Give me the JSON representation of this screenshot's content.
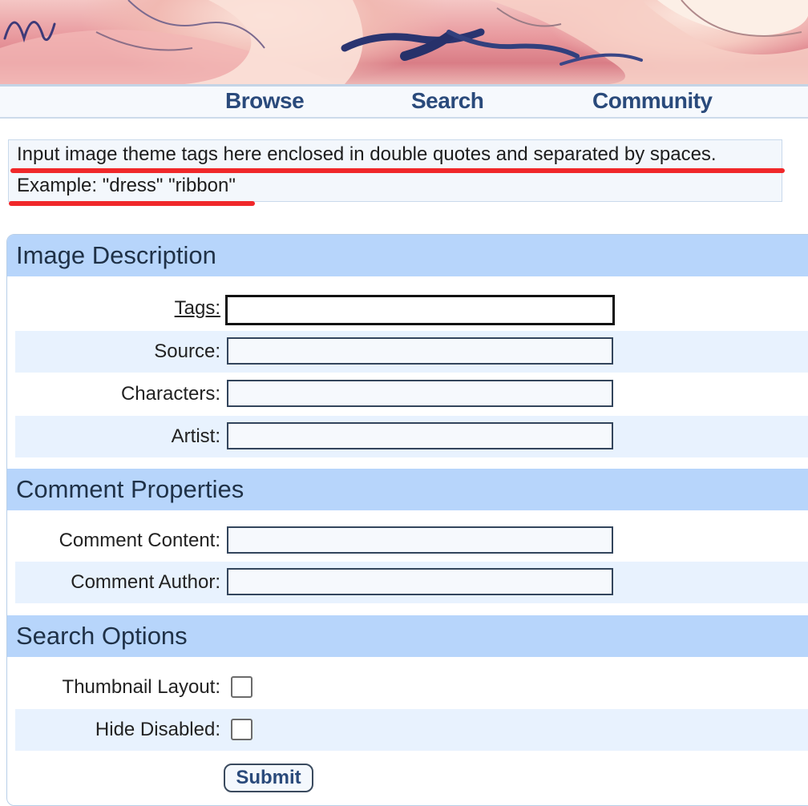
{
  "nav": {
    "browse": "Browse",
    "search": "Search",
    "community": "Community"
  },
  "notice": {
    "line1": "Input image theme tags here enclosed in double quotes and separated by spaces.",
    "line2": "Example: \"dress\" \"ribbon\""
  },
  "sections": {
    "image_description": {
      "title": "Image Description",
      "tags_label": "Tags:",
      "source_label": "Source:",
      "characters_label": "Characters:",
      "artist_label": "Artist:"
    },
    "comment_properties": {
      "title": "Comment Properties",
      "content_label": "Comment Content:",
      "author_label": "Comment Author:"
    },
    "search_options": {
      "title": "Search Options",
      "thumbnail_label": "Thumbnail Layout:",
      "hide_disabled_label": "Hide Disabled:"
    }
  },
  "form": {
    "tags_value": "",
    "source_value": "",
    "characters_value": "",
    "artist_value": "",
    "comment_content_value": "",
    "comment_author_value": "",
    "thumbnail_layout_checked": false,
    "hide_disabled_checked": false,
    "submit_label": "Submit"
  },
  "colors": {
    "nav_text": "#2a4a7b",
    "section_header": "#b7d5fb",
    "alt_row": "#e8f2fe",
    "annotation": "#f0282a"
  }
}
